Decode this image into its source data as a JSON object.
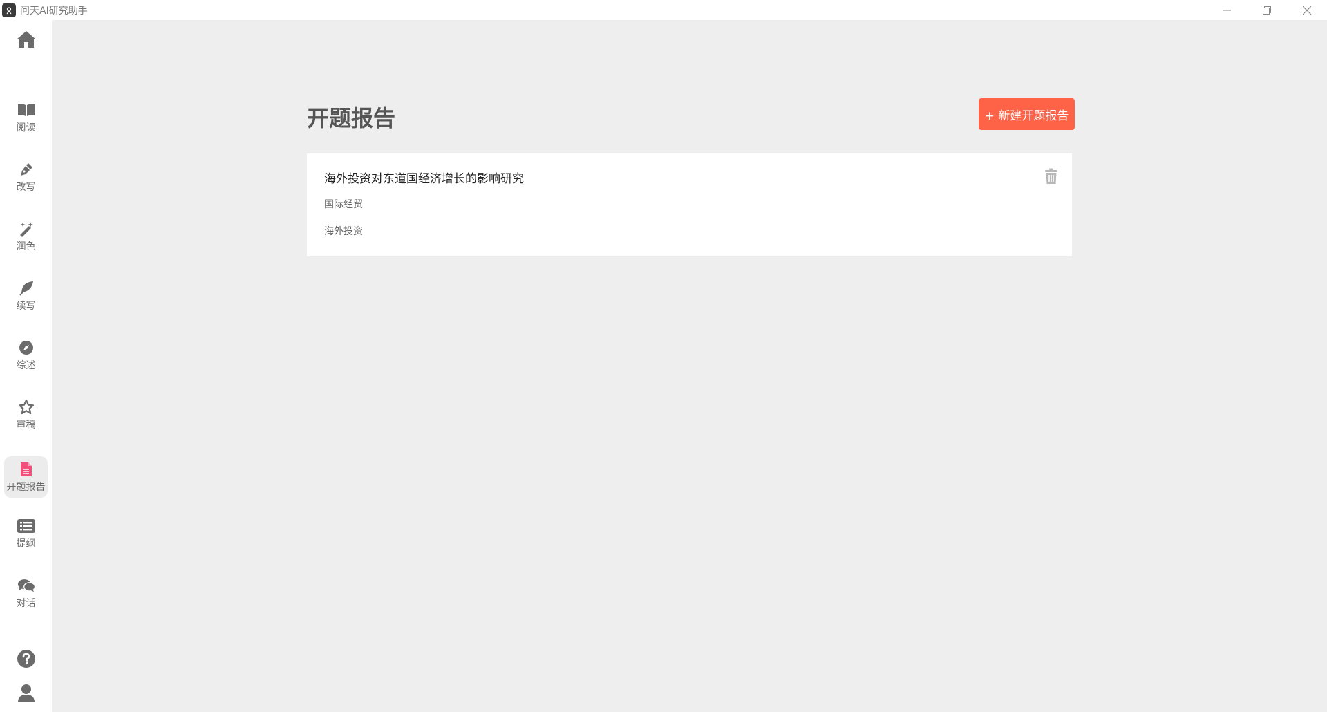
{
  "window": {
    "title": "问天AI研究助手"
  },
  "sidebar": {
    "items": [
      {
        "label": "阅读",
        "icon": "book-icon"
      },
      {
        "label": "改写",
        "icon": "pen-icon"
      },
      {
        "label": "润色",
        "icon": "magic-wand-icon"
      },
      {
        "label": "续写",
        "icon": "feather-icon"
      },
      {
        "label": "综述",
        "icon": "compass-icon"
      },
      {
        "label": "审稿",
        "icon": "star-icon"
      },
      {
        "label": "开题报告",
        "icon": "document-icon",
        "active": true
      },
      {
        "label": "提纲",
        "icon": "list-icon"
      },
      {
        "label": "对话",
        "icon": "chat-icon"
      }
    ]
  },
  "main": {
    "title": "开题报告",
    "new_button": "+ 新建开题报告",
    "reports": [
      {
        "title": "海外投资对东道国经济增长的影响研究",
        "field": "国际经贸",
        "keyword": "海外投资"
      }
    ]
  },
  "colors": {
    "accent": "#ff6347",
    "active_icon": "#f0507a",
    "icon_gray": "#6b6b6b"
  }
}
